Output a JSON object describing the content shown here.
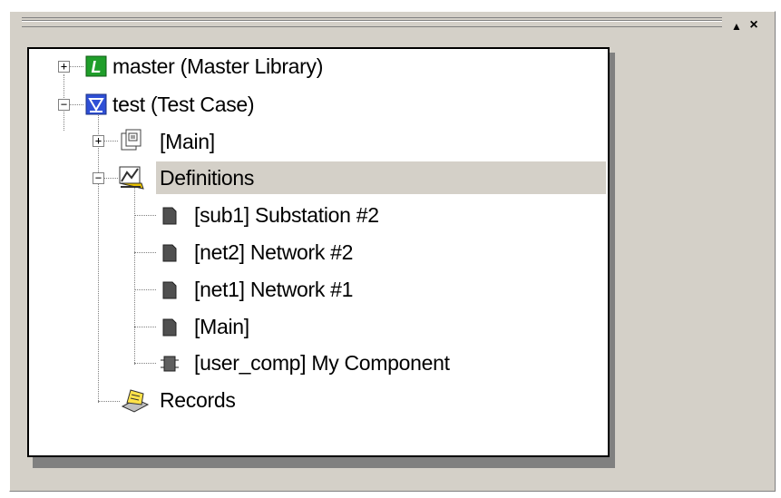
{
  "toolbar": {
    "up_glyph": "▲",
    "close_glyph": "×"
  },
  "tree": {
    "nodes": [
      {
        "label": "master (Master Library)",
        "icon": "library-L-icon",
        "expander": "+"
      },
      {
        "label": "test (Test Case)",
        "icon": "test-case-icon",
        "expander": "−"
      },
      {
        "label": "[Main]",
        "icon": "document-page-icon",
        "expander": "+"
      },
      {
        "label": "Definitions",
        "icon": "definitions-icon",
        "expander": "−",
        "selected": true
      },
      {
        "label": "[sub1] Substation #2",
        "icon": "definition-item-icon"
      },
      {
        "label": "[net2] Network #2",
        "icon": "definition-item-icon"
      },
      {
        "label": "[net1] Network #1",
        "icon": "definition-item-icon"
      },
      {
        "label": "[Main]",
        "icon": "definition-item-icon"
      },
      {
        "label": "[user_comp] My Component",
        "icon": "component-icon"
      },
      {
        "label": "Records",
        "icon": "records-icon"
      }
    ]
  },
  "colors": {
    "panel": "#d4d0c8",
    "library_green": "#1f9e2a",
    "test_blue": "#2e4fd6",
    "selection": "#d4d0c8"
  }
}
